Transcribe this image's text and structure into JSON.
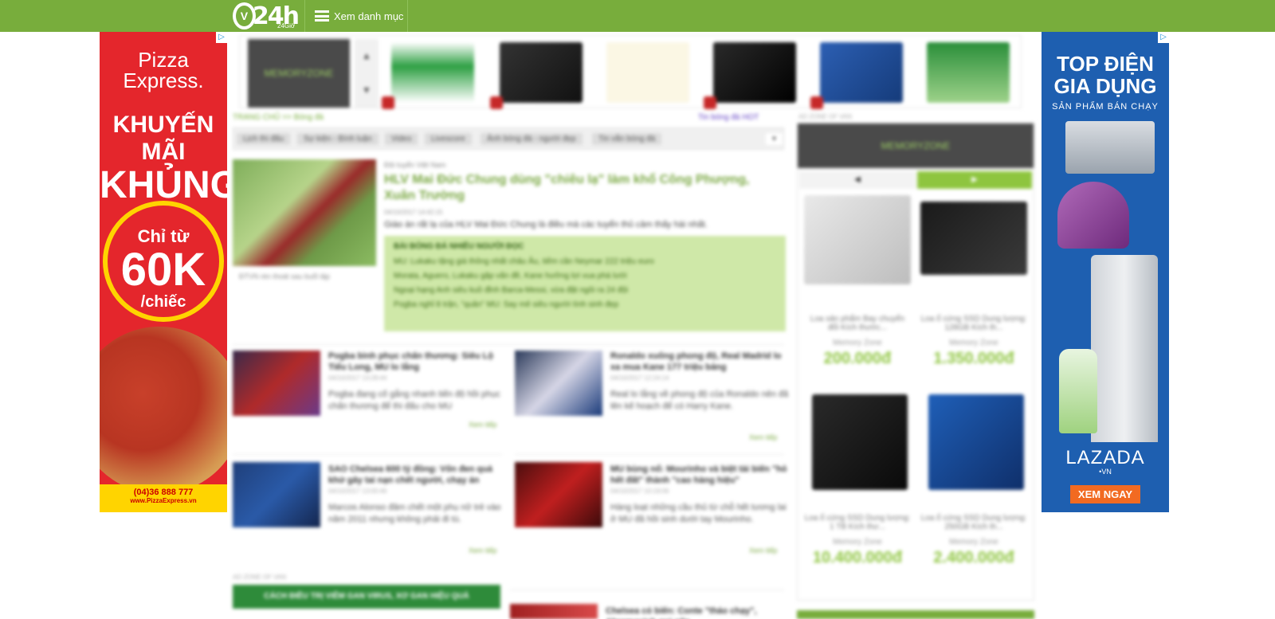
{
  "header": {
    "logo_mark": "V",
    "logo_text": "24h",
    "logo_sub": "24Giờ",
    "menu_label": "Xem danh mục"
  },
  "left_ad": {
    "brand": "Pizza Express.",
    "promo_line1": "KHUYẾN MÃI",
    "promo_line2": "KHỦNG",
    "badge_top": "Chỉ từ",
    "badge_value": "60K",
    "badge_unit": "/chiếc",
    "phone": "(04)36 888 777",
    "site": "www.PizzaExpress.vn",
    "adchoice": "▷"
  },
  "right_ad": {
    "headline_1": "TOP ĐIỆN",
    "headline_2": "GIA DỤNG",
    "sub": "SẢN PHẨM BÁN CHẠY",
    "brand": "LAZADA",
    "brand_suffix": "•VN",
    "cta": "XEM NGAY",
    "adchoice": "▷"
  },
  "content": {
    "strip_logo": "MEMORYZONE",
    "breadcrumb": "TRANG CHỦ >> Bóng đá",
    "hotlink": "Tin bóng đá HOT",
    "subnav": [
      "Lịch thi đấu",
      "Sự kiện - Bình luận",
      "Video",
      "Livescore",
      "Ảnh bóng đá - người đẹp",
      "Tin vắn bóng đá"
    ],
    "feature": {
      "category": "Đội tuyển Việt Nam",
      "title": "HLV Mai Đức Chung dùng \"chiêu lạ\" làm khổ Công Phượng, Xuân Trường",
      "time": "04/10/2017 14:42:15",
      "desc": "Giáo án rất lạ của HLV Mai Đức Chung là điều mà các tuyển thủ cảm thấy hài nhất.",
      "caption": "ĐTVN rèn thoát sau buổi tập",
      "related_head": "BÀI BÓNG ĐÁ NHIỀU NGƯỜI ĐỌC",
      "related": [
        "MU: Lukaku tặng giá thông nhất châu Âu, tiếm cần Neymar 222 triệu euro",
        "Morata, Aguero, Lukaku gặp vấn đề, Kane hưởng lợi vua phá lưới",
        "Ngoại hạng Anh siêu kuồ đỉnh Barca-Messi, vừa đặt ngôi ra 24 đội",
        "Pogba nghỉ 8 trận, \"quân\" MU: Say mê siêu người tình sinh đẹp"
      ]
    },
    "news": [
      {
        "title": "Pogba bình phục chấn thương: Siêu Lộ Tiểu Long, MU lo lắng",
        "time": "04/10/2017 13:28:44",
        "desc": "Pogba đang cố gắng nhanh tiến độ hồi phục chấn thương để thi đấu cho MU",
        "more": "Xem tiếp"
      },
      {
        "title": "Ronaldo xuống phong độ, Real Madrid lo xa mua Kane 177 triệu bảng",
        "time": "04/10/2017 12:24:14",
        "desc": "Real lo lắng về phong độ của Ronaldo nên đã lên kế hoạch để có Harry Kane.",
        "more": "Xem tiếp"
      },
      {
        "title": "SAO Chelsea 600 tỷ đồng: Vốn đen quá khứ gây tai nạn chết người, chạy án",
        "time": "04/10/2017 13:00:46",
        "desc": "Marcos Alonso đâm chết một phụ nữ trẻ vào năm 2011 nhưng không phải đi tù.",
        "more": "Xem tiếp"
      },
      {
        "title": "MU bùng nổ: Mourinho và biệt tài biến \"hỏ hết đất\" thành \"cao hàng hiệu\"",
        "time": "04/10/2017 10:19:06",
        "desc": "Hàng loạt những cầu thủ từ chỗ hết tương lai ở MU đã hồi sinh dưới tay Mourinho.",
        "more": "Xem tiếp"
      }
    ],
    "green_banner": "CÁCH ĐIỀU TRỊ VIÊM GAN VIRUS, XƠ GAN HIỆU QUẢ",
    "zone_label_1": "AD ZONE OF VAN",
    "zone_label_2": "AD ZONE OF VAN",
    "next_title": "Chelsea có biến: Conte \"tháo chạy\", Abramovich gọi gấp"
  },
  "side_ad": {
    "logo": "MEMORYZONE",
    "prev": "◀",
    "next": "▶",
    "products": [
      {
        "name": "Loa sản phẩm Bay chuyển đổi Kích thước...",
        "shop": "Memory Zone",
        "price": "200.000đ"
      },
      {
        "name": "Loa ổ cứng SSD Dung lượng: 128GB Kích th...",
        "shop": "Memory Zone",
        "price": "1.350.000đ"
      },
      {
        "name": "Loa ổ cứng SSD Dung lượng: 1 TB Kích thư...",
        "shop": "Memory Zone",
        "price": "10.400.000đ"
      },
      {
        "name": "Loa ổ cứng SSD Dung lượng: 250GB Kích th...",
        "shop": "Memory Zone",
        "price": "2.400.000đ"
      }
    ]
  }
}
